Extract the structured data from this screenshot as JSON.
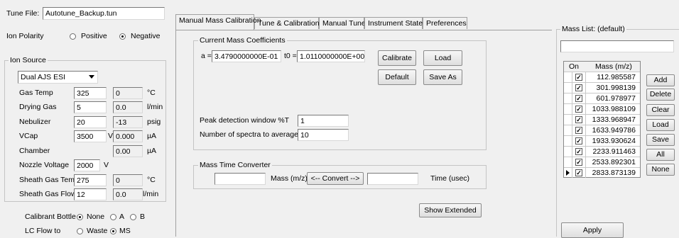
{
  "tune_file": {
    "label": "Tune File:",
    "value": "Autotune_Backup.tun"
  },
  "ion_polarity": {
    "label": "Ion Polarity",
    "positive": "Positive",
    "negative": "Negative",
    "selected": "Negative"
  },
  "ion_source": {
    "title": "Ion Source",
    "source_select": "Dual AJS ESI",
    "rows": [
      {
        "label": "Gas Temp",
        "setpoint": "325",
        "actual": "0",
        "unit": "°C"
      },
      {
        "label": "Drying Gas",
        "setpoint": "5",
        "actual": "0.0",
        "unit": "l/min"
      },
      {
        "label": "Nebulizer",
        "setpoint": "20",
        "actual": "-13",
        "unit": "psig"
      },
      {
        "label": "VCap",
        "setpoint": "3500",
        "setpoint_unit": "V",
        "actual": "0.000",
        "unit": "µA"
      },
      {
        "label": "Chamber",
        "setpoint": "",
        "actual": "0.00",
        "unit": "µA"
      },
      {
        "label": "Nozzle Voltage",
        "setpoint": "2000",
        "setpoint_unit": "V",
        "actual": "",
        "unit": ""
      },
      {
        "label": "Sheath Gas Temp",
        "setpoint": "275",
        "actual": "0",
        "unit": "°C"
      },
      {
        "label": "Sheath Gas Flow",
        "setpoint": "12",
        "actual": "0.0",
        "unit": "l/min"
      }
    ]
  },
  "calibrant_bottle": {
    "label": "Calibrant Bottle",
    "options": [
      "None",
      "A",
      "B"
    ],
    "selected": "None"
  },
  "lc_flow": {
    "label": "LC Flow to",
    "options": [
      "Waste",
      "MS"
    ],
    "selected": "MS"
  },
  "tabs": [
    "Manual Mass Calibration",
    "Tune & Calibration",
    "Manual Tune",
    "Instrument State",
    "Preferences"
  ],
  "active_tab": 0,
  "coefficients": {
    "title": "Current Mass Coefficients",
    "a_label": "a =",
    "a_value": "3.4790000000E-01",
    "t0_label": "t0 =",
    "t0_value": "1.0110000000E+00",
    "calibrate": "Calibrate",
    "load": "Load",
    "default": "Default",
    "save_as": "Save As",
    "peak_label": "Peak detection window %T",
    "peak_value": "1",
    "spectra_label": "Number of spectra to average",
    "spectra_value": "10"
  },
  "converter": {
    "title": "Mass Time Converter",
    "mass_label": "Mass (m/z)",
    "convert": "<-- Convert -->",
    "time_label": "Time (usec)",
    "mass_value": "",
    "time_value": ""
  },
  "show_extended": "Show Extended",
  "mass_list": {
    "title": "Mass List: (default)",
    "filter_value": "",
    "col_on": "On",
    "col_mass": "Mass (m/z)",
    "rows": [
      {
        "on": true,
        "mass": "112.985587"
      },
      {
        "on": true,
        "mass": "301.998139"
      },
      {
        "on": true,
        "mass": "601.978977"
      },
      {
        "on": true,
        "mass": "1033.988109"
      },
      {
        "on": true,
        "mass": "1333.968947"
      },
      {
        "on": true,
        "mass": "1633.949786"
      },
      {
        "on": true,
        "mass": "1933.930624"
      },
      {
        "on": true,
        "mass": "2233.911463"
      },
      {
        "on": true,
        "mass": "2533.892301"
      },
      {
        "on": true,
        "mass": "2833.873139"
      }
    ],
    "current_row": 9,
    "buttons": [
      "Add",
      "Delete",
      "Clear",
      "Load",
      "Save",
      "All",
      "None"
    ],
    "apply": "Apply"
  }
}
